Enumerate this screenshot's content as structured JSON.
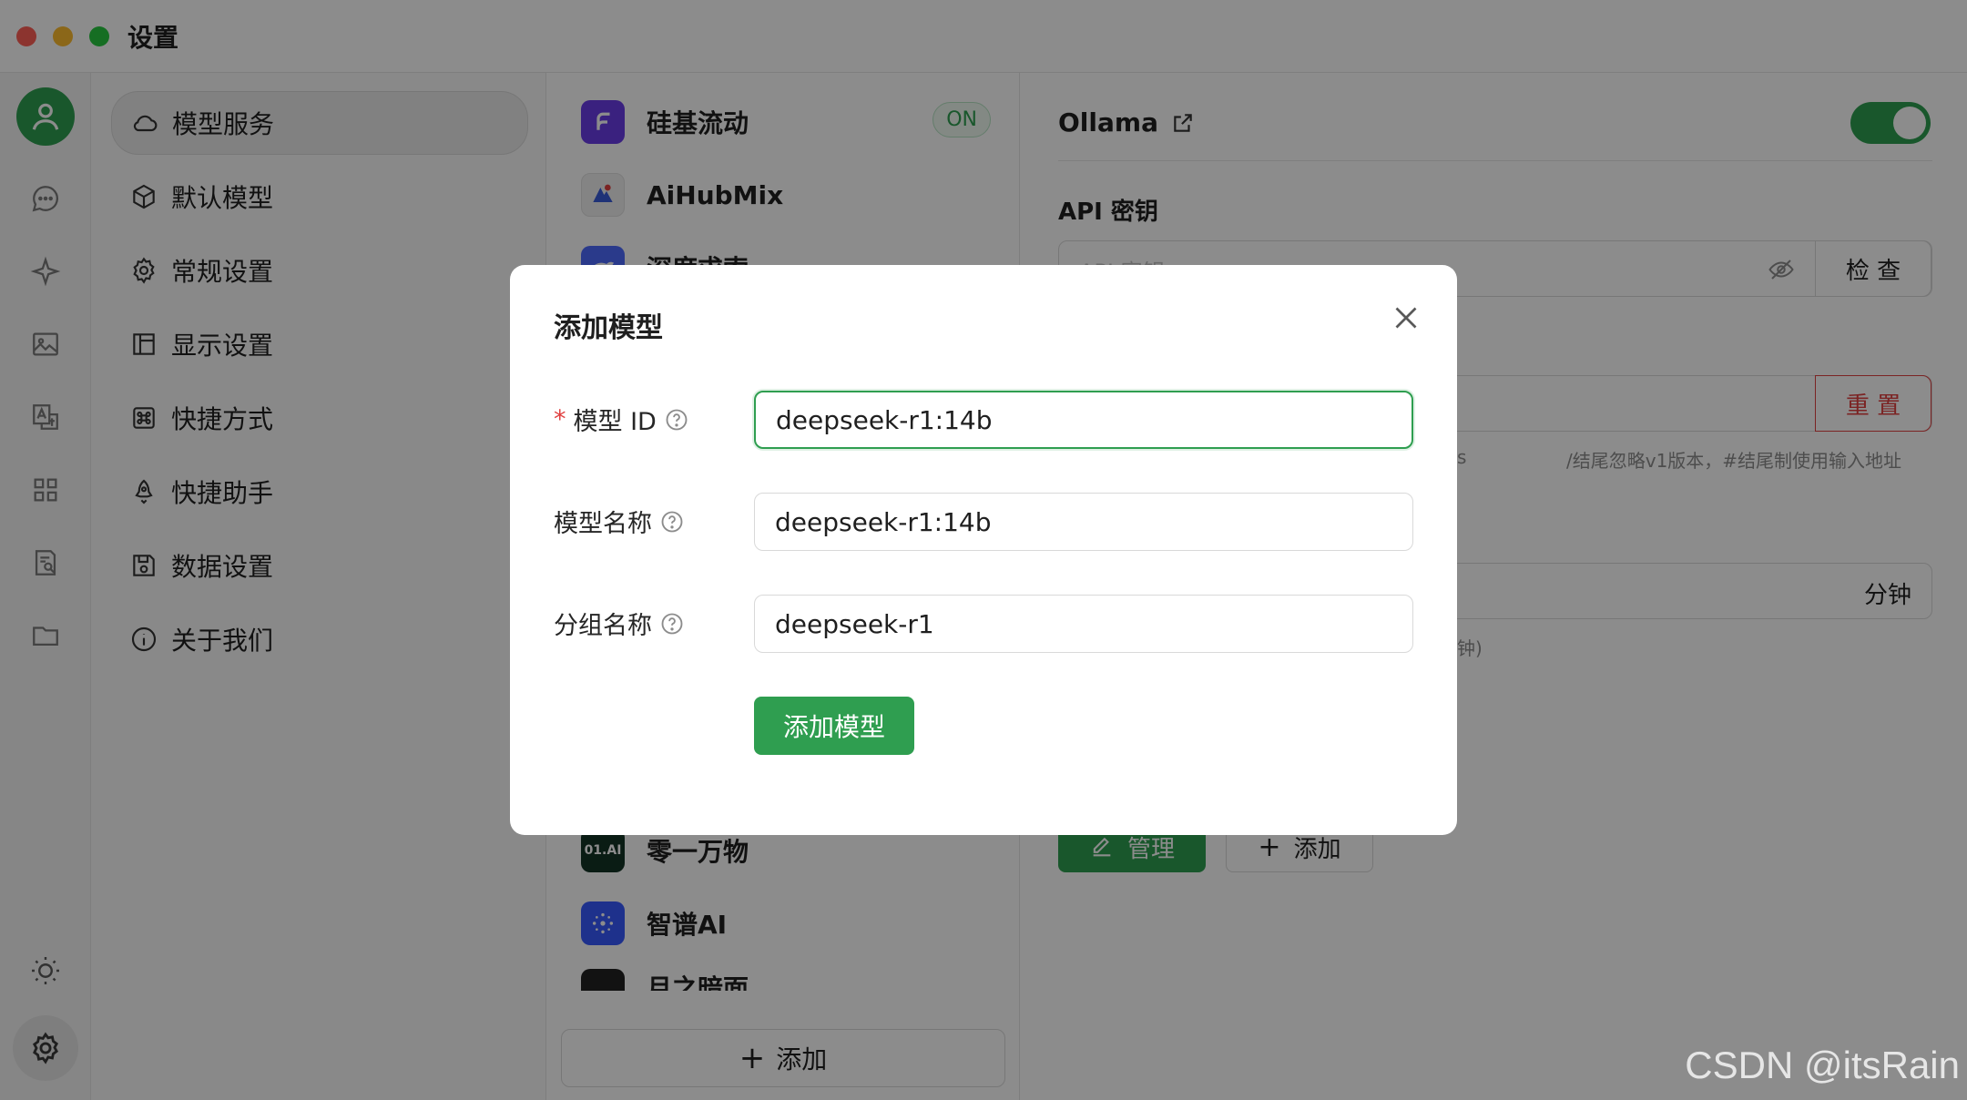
{
  "window": {
    "title": "设置"
  },
  "rail": {
    "icons": [
      "user-avatar-icon",
      "chat-icon",
      "sparkle-icon",
      "image-icon",
      "translate-icon",
      "apps-grid-icon",
      "document-search-icon",
      "folder-icon",
      "sun-icon",
      "gear-icon"
    ]
  },
  "nav": {
    "items": [
      {
        "label": "模型服务",
        "icon": "cloud-icon",
        "active": true
      },
      {
        "label": "默认模型",
        "icon": "cube-icon"
      },
      {
        "label": "常规设置",
        "icon": "gear-icon"
      },
      {
        "label": "显示设置",
        "icon": "layout-icon"
      },
      {
        "label": "快捷方式",
        "icon": "command-icon"
      },
      {
        "label": "快捷助手",
        "icon": "rocket-icon"
      },
      {
        "label": "数据设置",
        "icon": "save-icon"
      },
      {
        "label": "关于我们",
        "icon": "info-icon"
      }
    ]
  },
  "providers": {
    "items": [
      {
        "name": "硅基流动",
        "badge": "ON",
        "color": "#6a3de8"
      },
      {
        "name": "AiHubMix",
        "color": "#f0f0f0"
      },
      {
        "name": "深度求索",
        "color": "#4d6bfe"
      },
      {
        "name": "零一万物",
        "logo_text": "01.AI",
        "color": "#133426"
      },
      {
        "name": "智谱AI",
        "color": "#3859ff"
      },
      {
        "name": "月之暗面",
        "color": "#222222"
      }
    ],
    "add_label": "添加"
  },
  "detail": {
    "title": "Ollama",
    "api_key_label": "API 密钥",
    "api_key_placeholder": "API 密钥",
    "check_label": "检 查",
    "reset_label": "重 置",
    "url_hint_left": "s",
    "url_hint_right": "/结尾忽略v1版本，#结尾制使用输入地址",
    "keepalive_suffix": "分钟",
    "keepalive_hint": "钟)",
    "manage_label": "管理",
    "add_label": "添加",
    "enabled": true
  },
  "modal": {
    "title": "添加模型",
    "fields": [
      {
        "label": "模型 ID",
        "required": true,
        "value": "deepseek-r1:14b"
      },
      {
        "label": "模型名称",
        "value": "deepseek-r1:14b"
      },
      {
        "label": "分组名称",
        "value": "deepseek-r1"
      }
    ],
    "submit_label": "添加模型"
  },
  "watermark": "CSDN @itsRain",
  "colors": {
    "accent": "#2f9e50",
    "danger": "#e04040"
  }
}
